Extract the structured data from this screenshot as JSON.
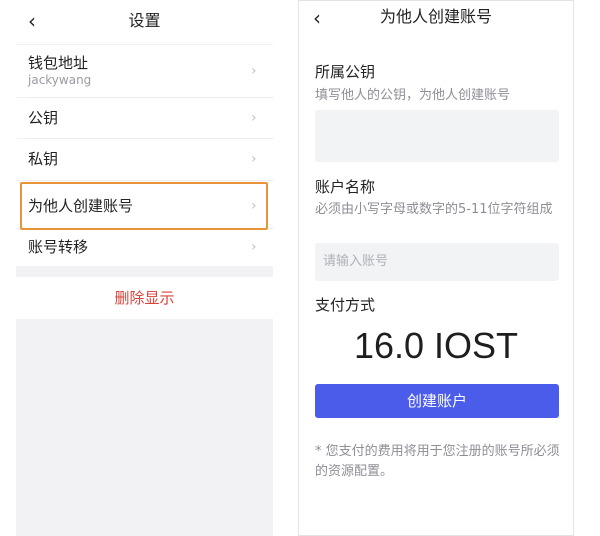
{
  "settings": {
    "title": "设置",
    "back_glyph": "‹",
    "items": [
      {
        "label": "钱包地址",
        "sub": "jackywang"
      },
      {
        "label": "公钥"
      },
      {
        "label": "私钥"
      },
      {
        "label": "为他人创建账号"
      },
      {
        "label": "账号转移"
      }
    ],
    "chevron_glyph": "›",
    "delete_label": "删除显示",
    "highlight_color": "#e8953a",
    "delete_color": "#d9433a"
  },
  "create_account": {
    "title": "为他人创建账号",
    "back_glyph": "‹",
    "public_key": {
      "label": "所属公钥",
      "hint": "填写他人的公钥，为他人创建账号"
    },
    "account_name": {
      "label": "账户名称",
      "hint": "必须由小写字母或数字的5-11位字符组成",
      "placeholder": "请输入账号"
    },
    "payment": {
      "label": "支付方式",
      "amount": "16.0 IOST"
    },
    "submit_label": "创建账户",
    "button_color": "#4b5ceb",
    "note": "* 您支付的费用将用于您注册的账号所必须的资源配置。"
  }
}
